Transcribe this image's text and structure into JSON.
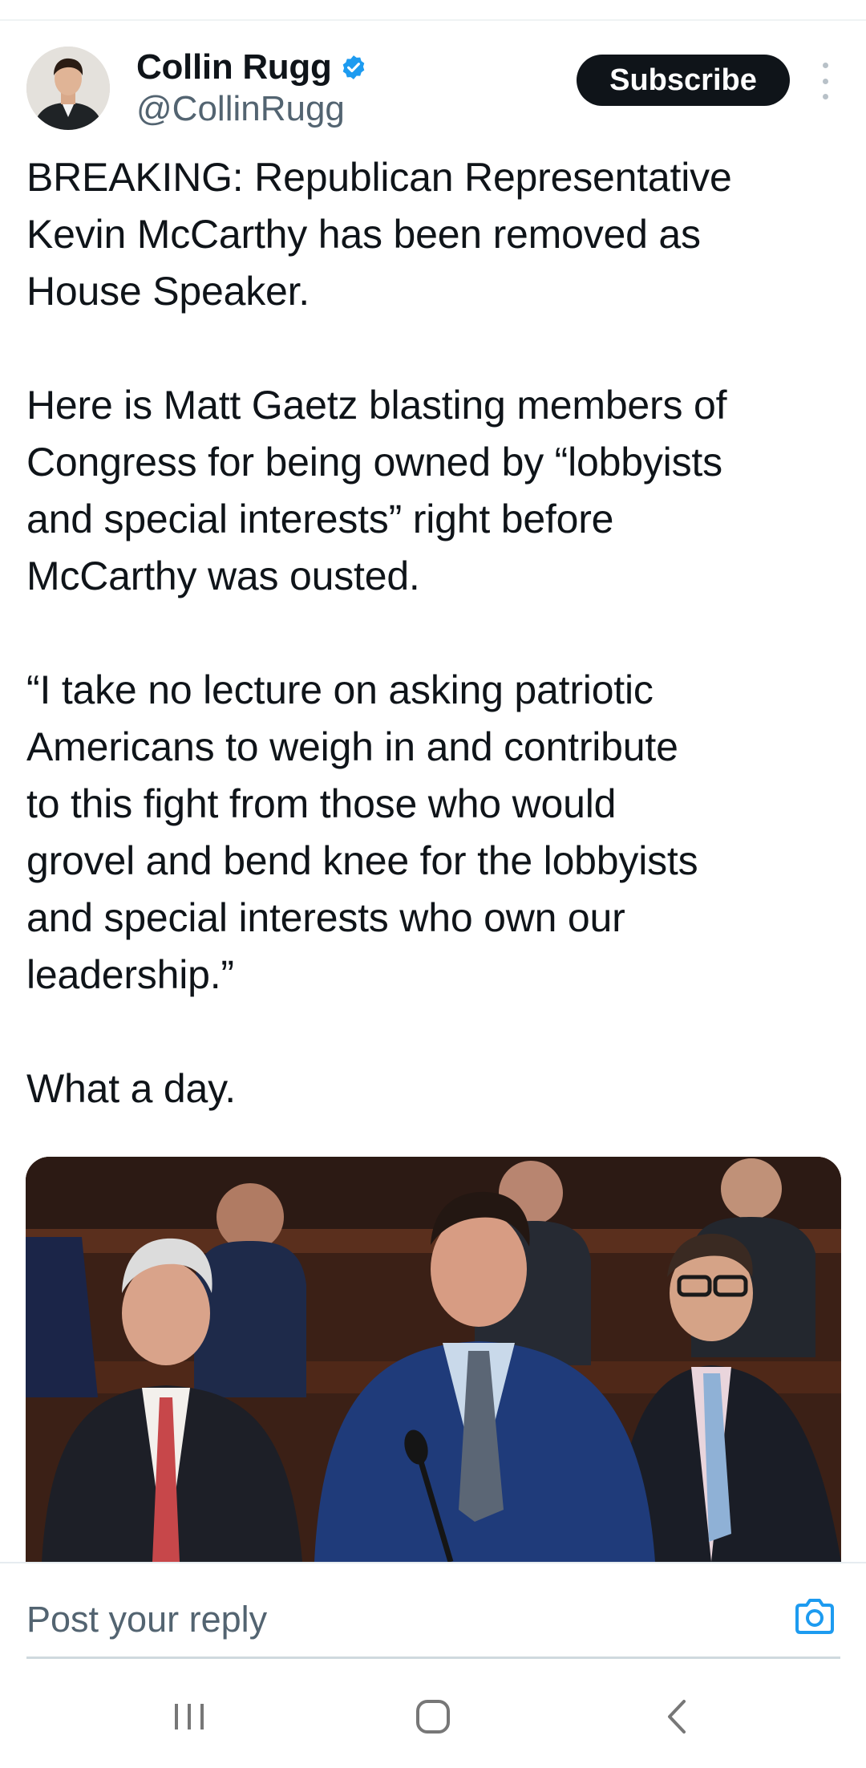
{
  "author": {
    "name": "Collin Rugg",
    "handle": "@CollinRugg",
    "verified_icon": "verified-badge-icon",
    "verified_color": "#1d9bf0"
  },
  "actions": {
    "subscribe_label": "Subscribe",
    "more_icon": "more-vertical-icon"
  },
  "post": {
    "text": "BREAKING: Republican Representative\nKevin McCarthy has been removed as\nHouse Speaker.\n\nHere is Matt Gaetz blasting members of\nCongress for being owned by “lobbyists\nand special interests” right before\nMcCarthy was ousted.\n\n“I take no lecture on asking patriotic\nAmericans to weigh in and contribute\nto this fight from those who would\ngrovel and bend knee for the lobbyists\nand special interests who own our\nleadership.”\n\nWhat a day."
  },
  "reply": {
    "placeholder": "Post your reply",
    "camera_icon": "camera-icon",
    "accent_color": "#1d9bf0"
  },
  "system_nav": {
    "recents_icon": "recents-icon",
    "home_icon": "home-icon",
    "back_icon": "back-icon"
  }
}
